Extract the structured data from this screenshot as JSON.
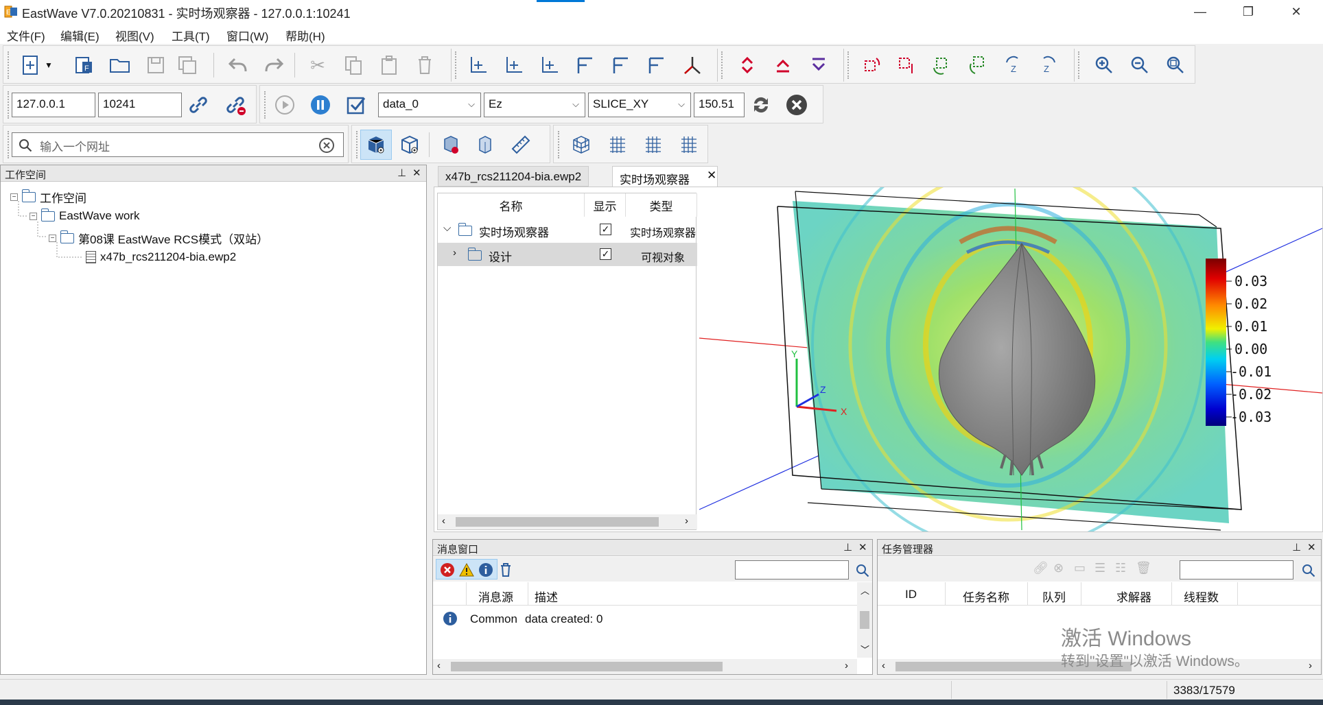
{
  "window": {
    "title": "EastWave V7.0.20210831  - 实时场观察器 - 127.0.0.1:10241",
    "minimize": "—",
    "restore": "❐",
    "close": "✕"
  },
  "menu": [
    "文件(F)",
    "编辑(E)",
    "视图(V)",
    "工具(T)",
    "窗口(W)",
    "帮助(H)"
  ],
  "connection": {
    "host": "127.0.0.1",
    "port": "10241",
    "data_select": "data_0",
    "component_select": "Ez",
    "slice_select": "SLICE_XY",
    "slice_value": "150.51"
  },
  "search": {
    "placeholder": "输入一个网址"
  },
  "workspace": {
    "title": "工作空间",
    "root": "工作空间",
    "work": "EastWave work",
    "lesson": "第08课 EastWave RCS模式（双站）",
    "file": "x47b_rcs211204-bia.ewp2"
  },
  "tabs": [
    {
      "label": "x47b_rcs211204-bia.ewp2"
    },
    {
      "label": "实时场观察器"
    }
  ],
  "observer_tree": {
    "columns": [
      "名称",
      "显示",
      "类型"
    ],
    "rows": [
      {
        "name": "实时场观察器",
        "type": "实时场观察器"
      },
      {
        "name": "设计",
        "type": "可视对象"
      }
    ]
  },
  "colorbar": {
    "ticks": [
      "0.03",
      "0.02",
      "0.01",
      "0.00",
      "-0.01",
      "-0.02",
      "-0.03"
    ]
  },
  "axes_labels": {
    "x": "X",
    "y": "Y",
    "z": "Z"
  },
  "messages": {
    "title": "消息窗口",
    "columns": [
      "消息源",
      "描述"
    ],
    "rows": [
      {
        "source": "Common",
        "desc": "data created: 0"
      }
    ]
  },
  "tasks": {
    "title": "任务管理器",
    "columns": [
      "ID",
      "任务名称",
      "队列",
      "求解器",
      "线程数"
    ]
  },
  "watermark": {
    "line1": "激活 Windows",
    "line2": "转到\"设置\"以激活 Windows。"
  },
  "status": {
    "count": "3383/17579"
  },
  "colors": {
    "accent": "#0078d7",
    "field_green": "#9fe06a",
    "model_gray": "#8a8a8a"
  }
}
